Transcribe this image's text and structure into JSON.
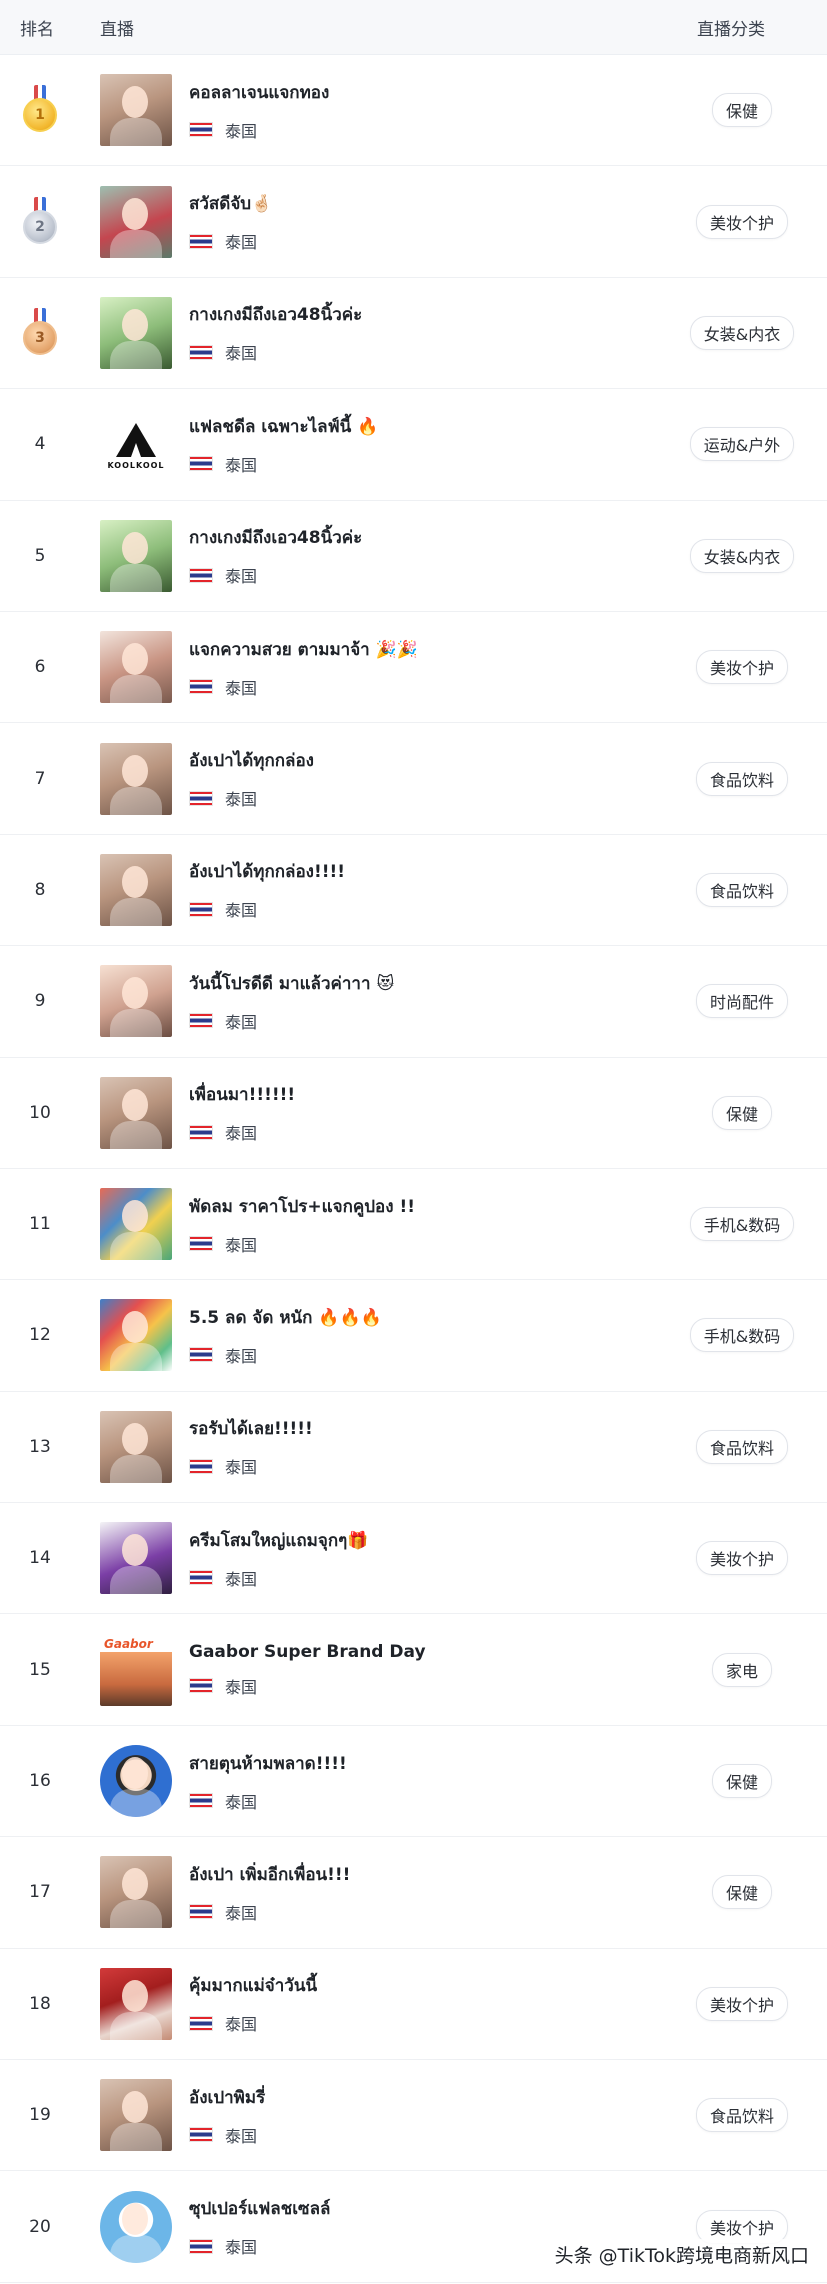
{
  "header": {
    "rank": "排名",
    "live": "直播",
    "category": "直播分类"
  },
  "rows": [
    {
      "rank": "1",
      "medal": "gold",
      "avatar": "p1",
      "title": "คอลลาเจนแจกทอง",
      "country": "泰国",
      "category": "保健"
    },
    {
      "rank": "2",
      "medal": "silver",
      "avatar": "p2",
      "title": "สวัสดีจับ🤞🏻",
      "country": "泰国",
      "category": "美妆个护"
    },
    {
      "rank": "3",
      "medal": "bronze",
      "avatar": "p3",
      "title": "กางเกงมีถึงเอว48นิ้วค่ะ",
      "country": "泰国",
      "category": "女装&内衣"
    },
    {
      "rank": "4",
      "medal": "",
      "avatar": "koolkool",
      "title": "แฟลชดีล เฉพาะไลฟ์นี้ 🔥",
      "country": "泰国",
      "category": "运动&户外"
    },
    {
      "rank": "5",
      "medal": "",
      "avatar": "p3",
      "title": "กางเกงมีถึงเอว48นิ้วค่ะ",
      "country": "泰国",
      "category": "女装&内衣"
    },
    {
      "rank": "6",
      "medal": "",
      "avatar": "p6",
      "title": "แจกความสวย ตามมาจ้า 🎉🎉",
      "country": "泰国",
      "category": "美妆个护"
    },
    {
      "rank": "7",
      "medal": "",
      "avatar": "p1",
      "title": "อังเปาได้ทุกกล่อง",
      "country": "泰国",
      "category": "食品饮料"
    },
    {
      "rank": "8",
      "medal": "",
      "avatar": "p1",
      "title": "อังเปาได้ทุกกล่อง!!!!",
      "country": "泰国",
      "category": "食品饮料"
    },
    {
      "rank": "9",
      "medal": "",
      "avatar": "p9",
      "title": "วันนี้โปรดีดี มาแล้วค่าาา 😻",
      "country": "泰国",
      "category": "时尚配件"
    },
    {
      "rank": "10",
      "medal": "",
      "avatar": "p1",
      "title": "เพื่อนมา!!!!!!",
      "country": "泰国",
      "category": "保健"
    },
    {
      "rank": "11",
      "medal": "",
      "avatar": "p11",
      "title": "พัดลม ราคาโปร+แจกคูปอง !!",
      "country": "泰国",
      "category": "手机&数码"
    },
    {
      "rank": "12",
      "medal": "",
      "avatar": "p12",
      "title": "5.5 ลด จัด หนัก 🔥🔥🔥",
      "country": "泰国",
      "category": "手机&数码"
    },
    {
      "rank": "13",
      "medal": "",
      "avatar": "p1",
      "title": "รอรับได้เลย!!!!!",
      "country": "泰国",
      "category": "食品饮料"
    },
    {
      "rank": "14",
      "medal": "",
      "avatar": "p14",
      "title": "ครีมโสมใหญ่แถมจุกๆ🎁",
      "country": "泰国",
      "category": "美妆个护"
    },
    {
      "rank": "15",
      "medal": "",
      "avatar": "gaabor",
      "title": "Gaabor Super Brand Day",
      "country": "泰国",
      "category": "家电"
    },
    {
      "rank": "16",
      "medal": "",
      "avatar": "p16",
      "title": "สายตุนห้ามพลาด!!!!",
      "country": "泰国",
      "category": "保健"
    },
    {
      "rank": "17",
      "medal": "",
      "avatar": "p1",
      "title": "อังเปา เพิ่มอีกเพื่อน!!!",
      "country": "泰国",
      "category": "保健"
    },
    {
      "rank": "18",
      "medal": "",
      "avatar": "p18",
      "title": "คุ้มมากแม่จ๋าวันนี้",
      "country": "泰国",
      "category": "美妆个护"
    },
    {
      "rank": "19",
      "medal": "",
      "avatar": "p1",
      "title": "อังเปาพิมรี่",
      "country": "泰国",
      "category": "食品饮料"
    },
    {
      "rank": "20",
      "medal": "",
      "avatar": "p20",
      "title": "ซุปเปอร์แฟลชเซลล์",
      "country": "泰国",
      "category": "美妆个护"
    }
  ],
  "logos": {
    "koolkool": "KOOLKOOL",
    "gaabor": "Gaabor"
  },
  "watermark": "头条 @TikTok跨境电商新风口"
}
